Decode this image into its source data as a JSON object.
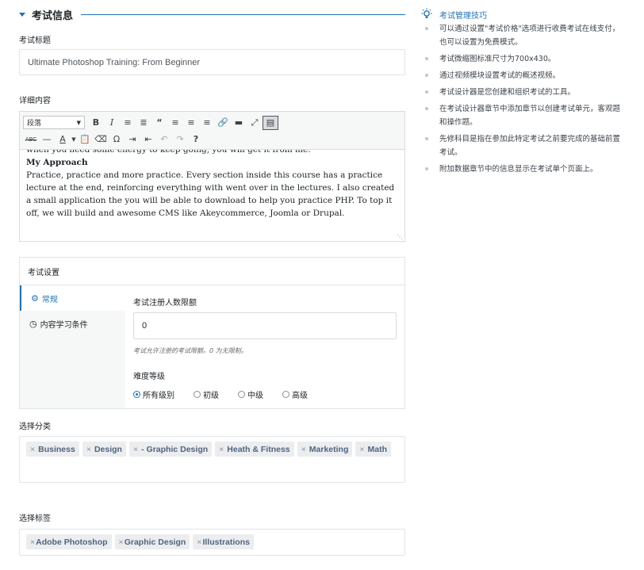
{
  "section": {
    "title": "考试信息"
  },
  "exam_title": {
    "label": "考试标题",
    "value": "Ultimate Photoshop Training: From Beginner"
  },
  "details": {
    "label": "详细内容",
    "toolbar": {
      "format_select": "段落",
      "row1_icons": [
        "B",
        "I",
        "☰",
        "☷",
        "❝",
        "≡",
        "≡",
        "≡",
        "🔗",
        "▬",
        "⤢",
        "▦"
      ],
      "row2_icons": [
        "ABC",
        "—",
        "A",
        "📋",
        "⌫",
        "Ω",
        "⇥",
        "⇤",
        "↶",
        "↷",
        "?"
      ]
    },
    "content": {
      "partial_line": "when you need some energy to keep going, you will get it from me.",
      "heading": "My Approach",
      "paragraph": "Practice, practice and more practice. Every section inside this course has a practice lecture at the end, reinforcing everything with went over in the lectures. I also created a small application the you will be able to download to help you practice PHP. To top it off, we will build and awesome CMS like Akeycommerce, Joomla or Drupal."
    }
  },
  "settings": {
    "title": "考试设置",
    "tabs": [
      {
        "label": "常规",
        "icon": "gear-icon"
      },
      {
        "label": "内容学习条件",
        "icon": "clock-icon"
      }
    ],
    "enroll_limit": {
      "label": "考试注册人数限额",
      "value": "0",
      "hint": "考试允许注册的考试限额。0 为无限制。"
    },
    "difficulty": {
      "label": "难度等级",
      "options": [
        "所有级别",
        "初级",
        "中级",
        "高级"
      ],
      "selected": "所有级别"
    }
  },
  "categories": {
    "label": "选择分类",
    "items": [
      "Business",
      "Design",
      "- Graphic Design",
      "Heath & Fitness",
      "Marketing",
      "Math"
    ]
  },
  "tags": {
    "label": "选择标签",
    "items": [
      "Adobe Photoshop",
      "Graphic Design",
      "Illustrations"
    ]
  },
  "tips": {
    "title": "考试管理技巧",
    "items": [
      "可以通过设置\"考试价格\"选项进行收费考试在线支付，也可以设置为免费模式。",
      "考试微缩图标准尺寸为700x430。",
      "通过视频模块设置考试的概述视频。",
      "考试设计器是您创建和组织考试的工具。",
      "在考试设计器章节中添加章节以创建考试单元，客观题和操作题。",
      "先修科目是指在参加此特定考试之前要完成的基础前置考试。",
      "附加数据章节中的信息显示在考试单个页面上。"
    ]
  },
  "colors": {
    "accent": "#2271b1",
    "tag_bg": "#ebedef",
    "tag_text": "#50647f"
  }
}
